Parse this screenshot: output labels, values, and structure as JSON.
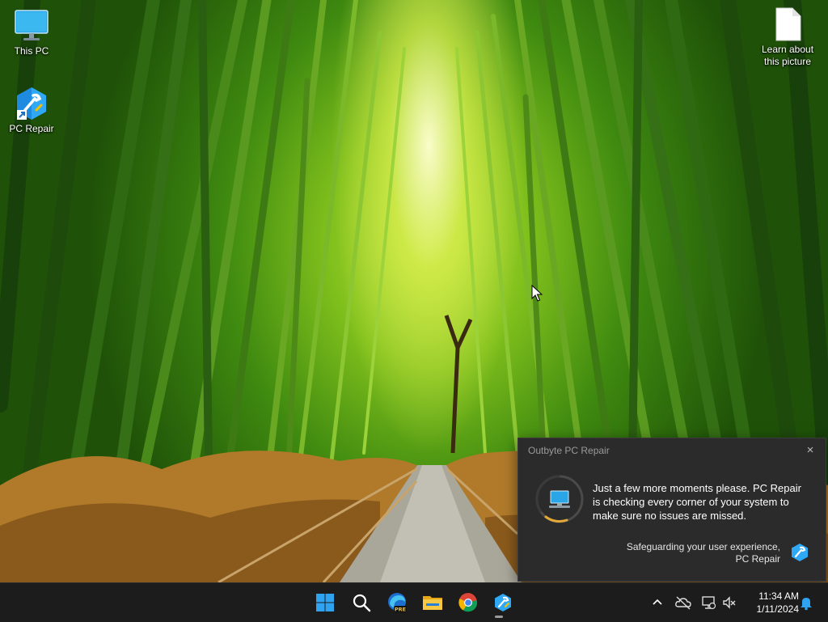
{
  "desktop": {
    "icons": [
      {
        "label": "This PC"
      },
      {
        "label": "PC Repair"
      },
      {
        "label": "Learn about\nthis picture"
      }
    ]
  },
  "notification": {
    "app_name": "Outbyte PC Repair",
    "close_label": "×",
    "message": "Just a few more moments please. PC Repair is checking every corner of your system to make sure no issues are missed.",
    "footer_line1": "Safeguarding your user experience,",
    "footer_line2": "PC Repair"
  },
  "taskbar": {
    "apps": [
      {
        "name": "Start",
        "icon": "windows-logo-icon"
      },
      {
        "name": "Search",
        "icon": "search-icon"
      },
      {
        "name": "Microsoft Edge Beta",
        "icon": "edge-icon"
      },
      {
        "name": "File Explorer",
        "icon": "folder-icon"
      },
      {
        "name": "Google Chrome",
        "icon": "chrome-icon"
      },
      {
        "name": "PC Repair",
        "icon": "pc-repair-icon"
      }
    ],
    "edge_badge": "PRE",
    "tray": {
      "time": "11:34 AM",
      "date": "1/11/2024"
    }
  },
  "colors": {
    "taskbar_bg": "#1c1c1c",
    "toast_bg": "#2b2b2b",
    "accent_blue": "#0a84e0"
  }
}
